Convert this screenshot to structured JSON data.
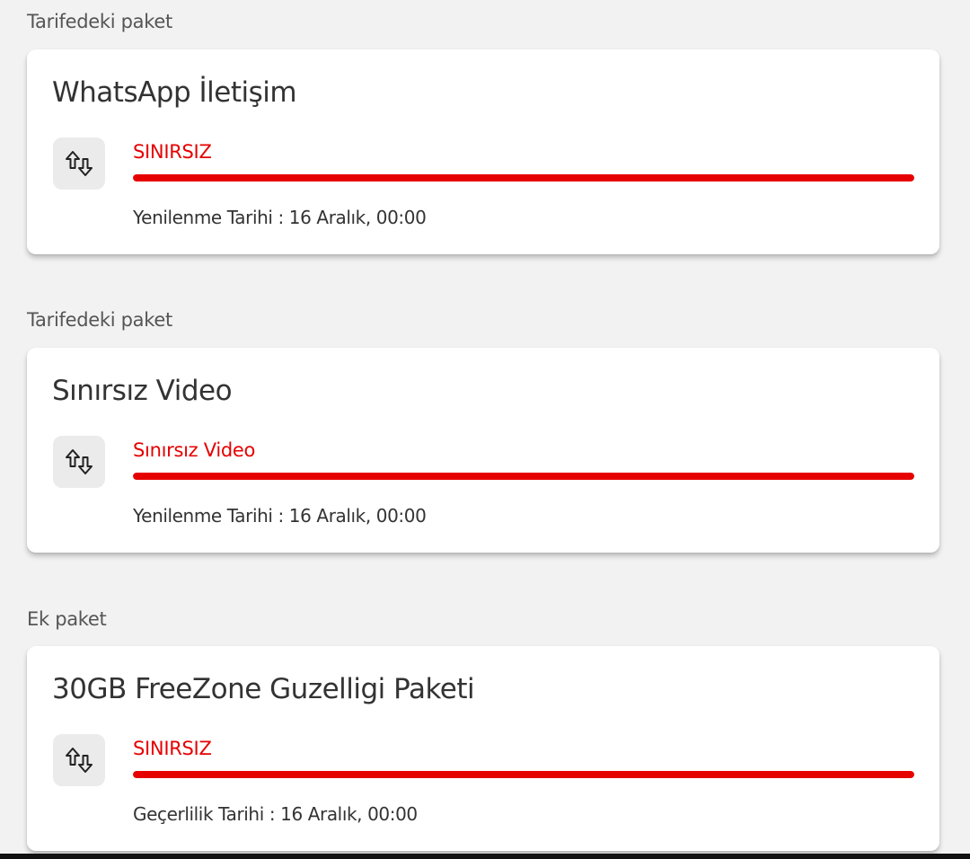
{
  "packages": [
    {
      "section_label": "Tarifedeki paket",
      "title": "WhatsApp İletişim",
      "icon": "data-transfer-arrows-icon",
      "usage_label": "SINIRSIZ",
      "usage_fraction": 1.0,
      "date_text": "Yenilenme Tarihi : 16 Aralık, 00:00"
    },
    {
      "section_label": "Tarifedeki paket",
      "title": "Sınırsız Video",
      "icon": "data-transfer-arrows-icon",
      "usage_label": "Sınırsız Video",
      "usage_fraction": 1.0,
      "date_text": "Yenilenme Tarihi : 16 Aralık, 00:00"
    },
    {
      "section_label": "Ek paket",
      "title": "30GB FreeZone Guzelligi Paketi",
      "icon": "data-transfer-arrows-icon",
      "usage_label": "SINIRSIZ",
      "usage_fraction": 1.0,
      "date_text": "Geçerlilik Tarihi : 16 Aralık, 00:00"
    }
  ],
  "colors": {
    "accent": "#e60000",
    "background": "#f2f2f2",
    "card": "#ffffff",
    "icon_background": "#ebebeb"
  }
}
